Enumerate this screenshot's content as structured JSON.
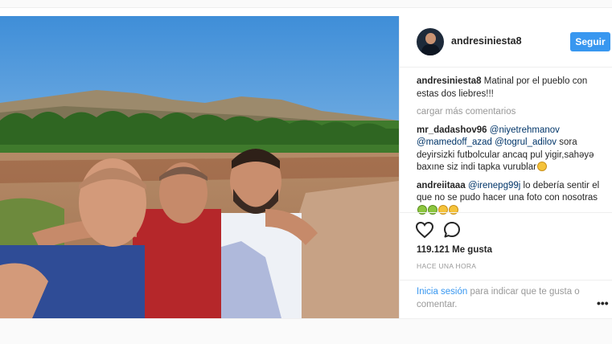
{
  "post": {
    "username": "andresiniesta8",
    "follow_label": "Seguir",
    "caption": {
      "user": "andresiniesta8",
      "text": "Matinal por el pueblo con estas dos liebres!!!"
    },
    "load_more": "cargar más comentarios",
    "comments": [
      {
        "user": "mr_dadashov96",
        "mention1": "@niyetrehmanov",
        "mention2": "@mamedoff_azad",
        "mention3": "@togrul_adilov",
        "text": "sora deyirsizki futbolcular ancaq pul yigir,sahəyə baxıne siz indi tapka vurublar"
      },
      {
        "user": "andreiitaaa",
        "mention1": "@irenepg99j",
        "text": "lo debería sentir el que no se pudo hacer una foto con nosotras"
      }
    ],
    "likes": "119.121 Me gusta",
    "time": "HACE UNA HORA",
    "login_link": "Inicia sesión",
    "login_text": "para indicar que te gusta o comentar.",
    "more_label": "•••"
  },
  "icons": {
    "heart": "heart-icon",
    "comment": "comment-icon",
    "more": "more-options-icon"
  },
  "colors": {
    "accent": "#3897f0",
    "mention": "#003569",
    "muted": "#999999"
  }
}
